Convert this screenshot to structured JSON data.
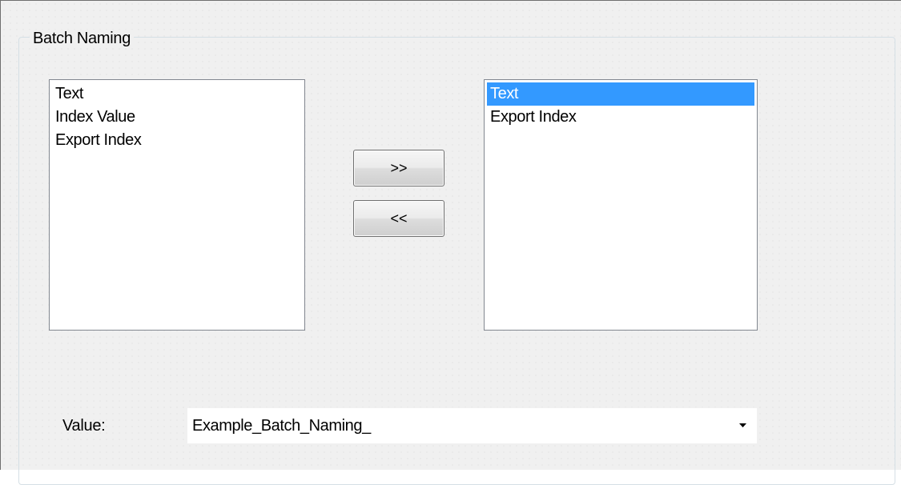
{
  "group": {
    "title": "Batch Naming"
  },
  "available_list": {
    "items": [
      {
        "label": "Text"
      },
      {
        "label": "Index Value"
      },
      {
        "label": "Export Index"
      }
    ]
  },
  "selected_list": {
    "items": [
      {
        "label": "Text",
        "selected": true
      },
      {
        "label": "Export Index",
        "selected": false
      }
    ]
  },
  "buttons": {
    "add_label": ">>",
    "remove_label": "<<"
  },
  "value_field": {
    "label": "Value:",
    "value": "Example_Batch_Naming_",
    "icon": "chevron-down-icon"
  },
  "colors": {
    "selection_highlight": "#3399ff",
    "dialog_background": "#f0f0f0",
    "list_border": "#828790"
  }
}
